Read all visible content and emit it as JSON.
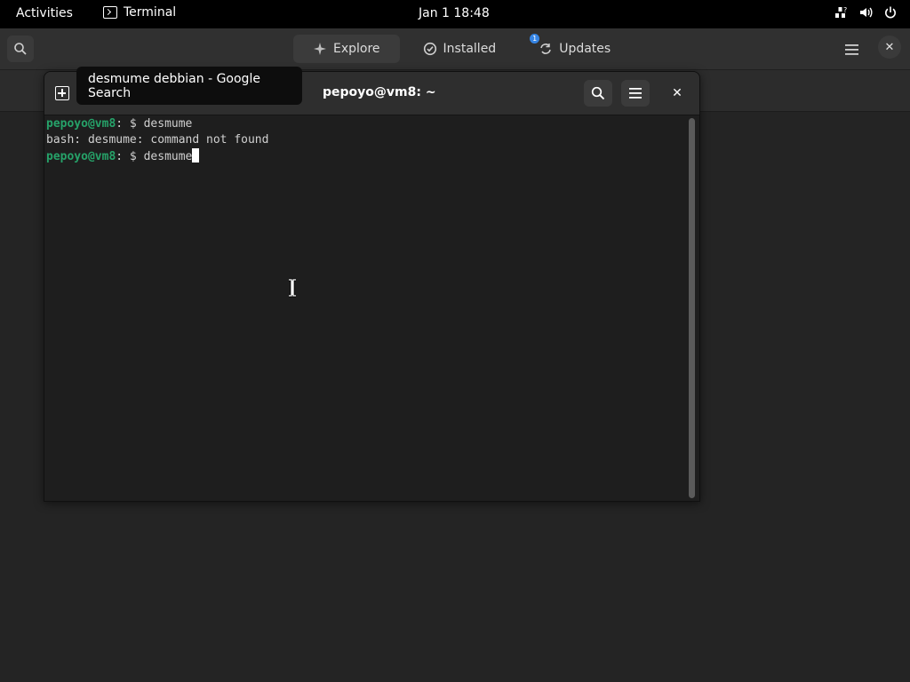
{
  "topbar": {
    "activities": "Activities",
    "app_name": "Terminal",
    "clock": "Jan 1  18:48",
    "tray_icons": [
      "network-question-icon",
      "volume-icon",
      "power-icon"
    ]
  },
  "software": {
    "tabs": [
      {
        "label": "Explore",
        "icon": "sparkle-icon"
      },
      {
        "label": "Installed",
        "icon": "check-circle-icon"
      },
      {
        "label": "Updates",
        "icon": "refresh-icon",
        "badge": "1"
      }
    ]
  },
  "terminal": {
    "title": "pepoyo@vm8: ~",
    "lines": [
      {
        "user": "pepoyo@vm8",
        "rest": ": $ desmume"
      },
      {
        "text": "bash: desmume: command not found"
      },
      {
        "user": "pepoyo@vm8",
        "rest": ": $ desmume"
      }
    ]
  },
  "tooltip": {
    "text": "desmume debbian - Google Search"
  },
  "colors": {
    "prompt_user": "#26a269",
    "accent": "#3584e4"
  }
}
